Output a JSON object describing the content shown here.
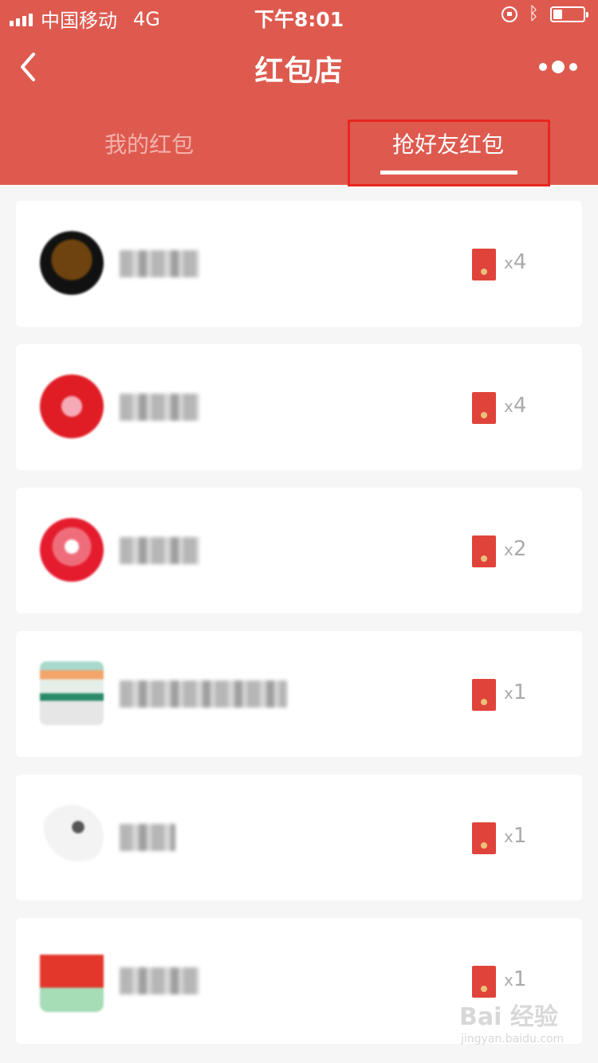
{
  "status_bar": {
    "carrier": "中国移动",
    "network": "4G",
    "time": "下午8:01"
  },
  "nav": {
    "title": "红包店",
    "back_icon": "chevron-left-icon",
    "more_icon": "more-dots-icon"
  },
  "tabs": [
    {
      "label": "我的红包",
      "active": false
    },
    {
      "label": "抢好友红包",
      "active": true
    }
  ],
  "colors": {
    "header": "#de5a4f",
    "envelope": "#e0433a",
    "highlight_box": "#e8261f"
  },
  "friends": [
    {
      "name": "",
      "count_prefix": "x",
      "count": "4"
    },
    {
      "name": "",
      "count_prefix": "x",
      "count": "4"
    },
    {
      "name": "",
      "count_prefix": "x",
      "count": "2"
    },
    {
      "name": "",
      "count_prefix": "x",
      "count": "1"
    },
    {
      "name": "",
      "count_prefix": "x",
      "count": "1"
    },
    {
      "name": "",
      "count_prefix": "x",
      "count": "1"
    }
  ],
  "watermark": {
    "text": "Bai 经验",
    "sub": "jingyan.baidu.com"
  }
}
